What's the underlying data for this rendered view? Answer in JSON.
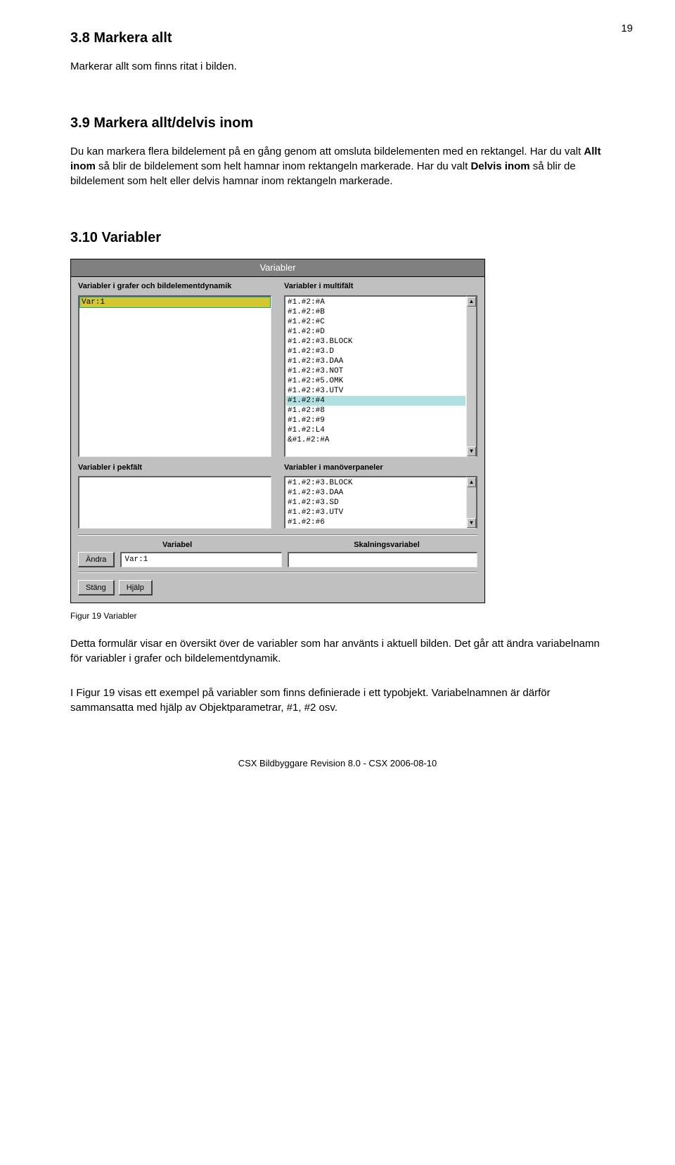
{
  "page": {
    "number": "19"
  },
  "sec38": {
    "heading": "3.8  Markera allt",
    "para": "Markerar allt som finns ritat i bilden."
  },
  "sec39": {
    "heading": "3.9  Markera allt/delvis inom",
    "para1a": "Du kan markera flera bildelement på en gång genom att omsluta bildelementen med en rektangel. Har du valt ",
    "para1b": "Allt inom",
    "para1c": " så blir de bildelement som helt hamnar inom rektangeln markerade. Har du valt ",
    "para1d": "Delvis inom",
    "para1e": " så blir de bildelement som helt eller delvis hamnar inom rektangeln markerade."
  },
  "sec310": {
    "heading": "3.10  Variabler"
  },
  "dialog": {
    "title": "Variabler",
    "labels": {
      "topleft": "Variabler i grafer och bildelementdynamik",
      "topright": "Variabler i multifält",
      "botleft": "Variabler i pekfält",
      "botright": "Variabler i manöverpaneler",
      "variabel": "Variabel",
      "skalning": "Skalningsvariabel",
      "andra": "Ändra",
      "stang": "Stäng",
      "hjalp": "Hjälp"
    },
    "topleft_items": [
      "Var:1"
    ],
    "topright_items": [
      "#1.#2:#A",
      "#1.#2:#B",
      "#1.#2:#C",
      "#1.#2:#D",
      "#1.#2:#3.BLOCK",
      "#1.#2:#3.D",
      "#1.#2:#3.DAA",
      "#1.#2:#3.NOT",
      "#1.#2:#5.OMK",
      "#1.#2:#3.UTV",
      "#1.#2:#4",
      "#1.#2:#8",
      "#1.#2:#9",
      "#1.#2:L4",
      "&#1.#2:#A"
    ],
    "botright_items": [
      "#1.#2:#3.BLOCK",
      "#1.#2:#3.DAA",
      "#1.#2:#3.SD",
      "#1.#2:#3.UTV",
      "#1.#2:#6"
    ],
    "input_value": "Var:1"
  },
  "caption": "Figur 19 Variabler",
  "bodytext": {
    "p1": "Detta formulär visar en översikt över de variabler som har använts i aktuell bilden. Det går att ändra variabelnamn för variabler i grafer och bildelementdynamik.",
    "p2": "I Figur 19 visas ett exempel på variabler som finns definierade i ett typobjekt. Variabelnamnen är därför sammansatta med hjälp av Objektparametrar, #1, #2 osv."
  },
  "footer": "CSX Bildbyggare Revision 8.0 - CSX 2006-08-10"
}
